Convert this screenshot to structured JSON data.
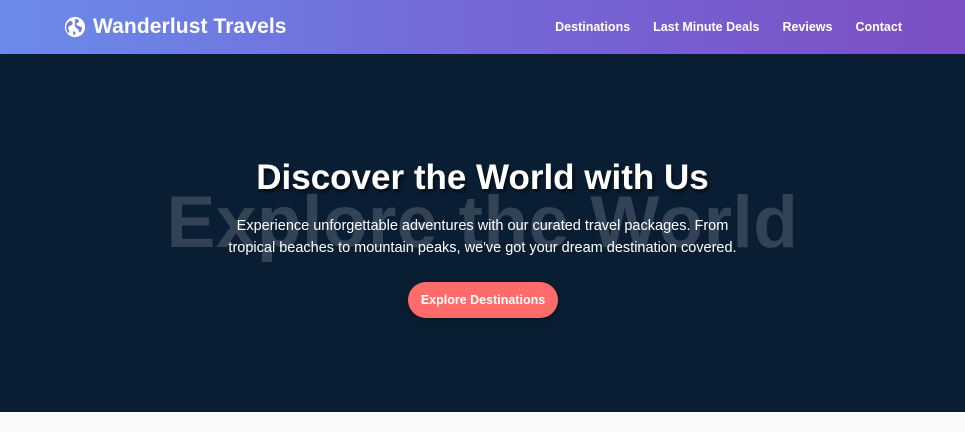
{
  "brand": {
    "name": "Wanderlust Travels",
    "icon": "globe-icon"
  },
  "nav": {
    "items": [
      {
        "label": "Destinations"
      },
      {
        "label": "Last Minute Deals"
      },
      {
        "label": "Reviews"
      },
      {
        "label": "Contact"
      }
    ]
  },
  "hero": {
    "background_text": "Explore the World",
    "title": "Discover the World with Us",
    "subtitle": "Experience unforgettable adventures with our curated travel packages. From tropical beaches to mountain peaks, we've got your dream destination covered.",
    "cta_label": "Explore Destinations"
  },
  "colors": {
    "nav_gradient_start": "#6a8bea",
    "nav_gradient_end": "#7c4fc4",
    "hero_background": "#0a1e33",
    "cta": "#ff6b6b"
  }
}
